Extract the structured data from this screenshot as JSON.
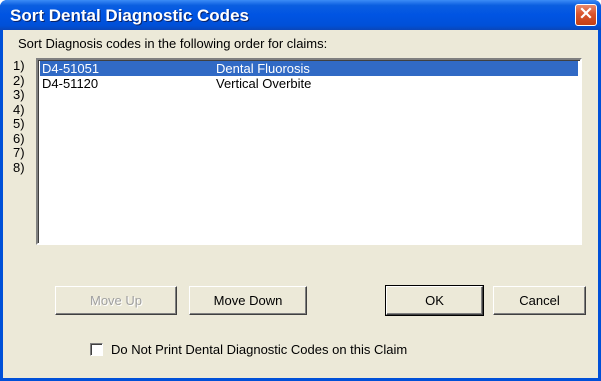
{
  "window": {
    "title": "Sort Dental Diagnostic Codes",
    "close_icon": "close-icon"
  },
  "instruction": "Sort Diagnosis codes in the following order for claims:",
  "row_numbers": [
    "1)",
    "2)",
    "3)",
    "4)",
    "5)",
    "6)",
    "7)",
    "8)"
  ],
  "codes": [
    {
      "code": "D4-51051",
      "description": "Dental Fluorosis",
      "selected": true
    },
    {
      "code": "D4-51120",
      "description": "Vertical Overbite",
      "selected": false
    }
  ],
  "buttons": {
    "move_up": "Move Up",
    "move_down": "Move Down",
    "ok": "OK",
    "cancel": "Cancel"
  },
  "checkbox": {
    "label": "Do Not Print Dental Diagnostic Codes on this Claim",
    "checked": false
  },
  "colors": {
    "titlebar": "#0054e3",
    "selection": "#316ac5",
    "dialog_face": "#ece9d8",
    "close_button": "#d9542c"
  }
}
